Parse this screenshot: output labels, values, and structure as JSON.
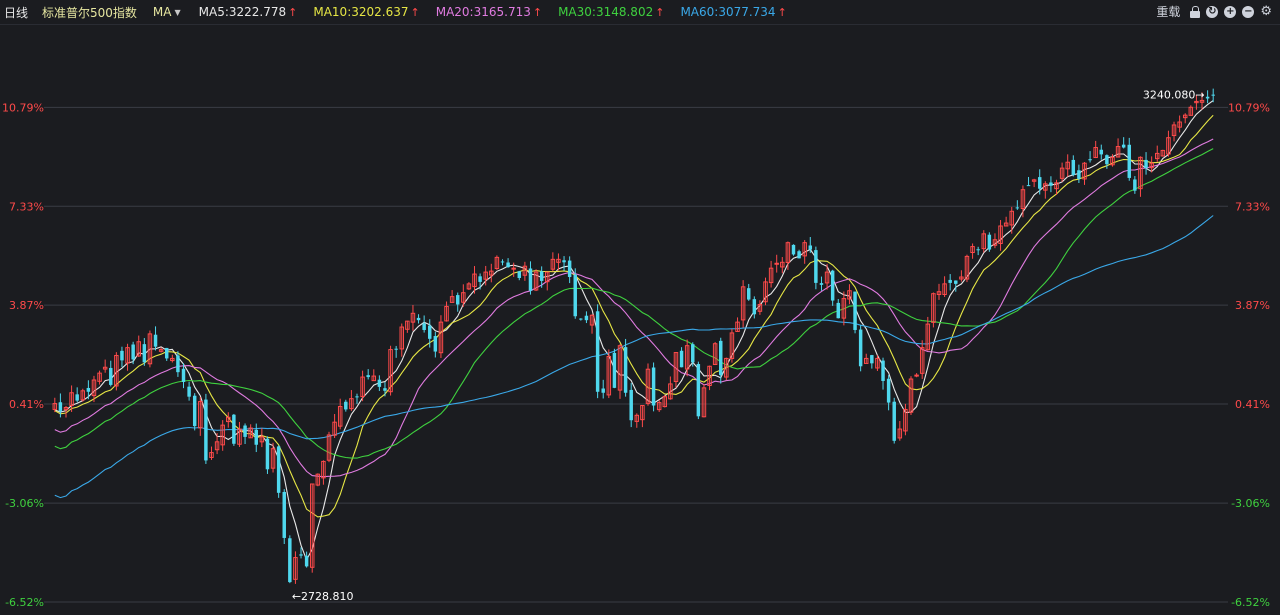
{
  "header": {
    "period": "日线",
    "index_name": "标准普尔500指数",
    "ma_menu": "MA",
    "ma_items": [
      {
        "label": "MA5:3222.778",
        "color": "#e8e8e8"
      },
      {
        "label": "MA10:3202.637",
        "color": "#e6e645"
      },
      {
        "label": "MA20:3165.713",
        "color": "#e07be0"
      },
      {
        "label": "MA30:3148.802",
        "color": "#3fd13f"
      },
      {
        "label": "MA60:3077.734",
        "color": "#3aa8e8"
      }
    ],
    "arrow": "↑",
    "reload": "重载"
  },
  "colors": {
    "up": "#ff4a4a",
    "down": "#4fd8ee",
    "grid": "#3a3c44",
    "neg_label": "#3fd13f",
    "pos_label": "#ff4a4a"
  },
  "chart_data": {
    "type": "candlestick",
    "y_tick_labels": [
      "10.79%",
      "7.33%",
      "3.87%",
      "0.41%",
      "-3.06%",
      "-6.52%"
    ],
    "y_pct_ticks": [
      10.79,
      7.33,
      3.87,
      0.41,
      -3.06,
      -6.52
    ],
    "base_price": 2912.6,
    "ylim_pct": [
      -6.52,
      13.5
    ],
    "annotations": [
      {
        "text": "3240.080→",
        "price": 3240.08,
        "index": 206
      },
      {
        "text": "←2728.810",
        "price": 2728.81,
        "index": 42
      }
    ],
    "close": [
      2925,
      2917,
      2921,
      2936,
      2928,
      2938,
      2937,
      2949,
      2956,
      2962,
      2944,
      2974,
      2969,
      2982,
      2970,
      2988,
      2967,
      2996,
      2983,
      2980,
      2971,
      2971,
      2957,
      2947,
      2932,
      2902,
      2927,
      2867,
      2875,
      2886,
      2903,
      2911,
      2884,
      2899,
      2891,
      2900,
      2883,
      2891,
      2858,
      2879,
      2834,
      2788,
      2743,
      2768,
      2770,
      2759,
      2843,
      2853,
      2866,
      2893,
      2906,
      2922,
      2919,
      2930,
      2932,
      2952,
      2952,
      2953,
      2942,
      2938,
      2980,
      2980,
      3003,
      3009,
      3017,
      3010,
      3000,
      2991,
      2978,
      3008,
      3024,
      3034,
      3026,
      3038,
      3047,
      3057,
      3049,
      3059,
      3060,
      3074,
      3069,
      3064,
      3063,
      3053,
      3065,
      3040,
      3059,
      3050,
      3059,
      3072,
      3072,
      3069,
      3054,
      3014,
      3011,
      3010,
      3015,
      2937,
      2936,
      2973,
      2941,
      2984,
      2936,
      2908,
      2913,
      2923,
      2960,
      2923,
      2926,
      2932,
      2945,
      2977,
      2962,
      2984,
      2967,
      2912,
      2941,
      2963,
      2986,
      2954,
      2971,
      2997,
      3008,
      3044,
      3031,
      3016,
      3026,
      3049,
      3063,
      3068,
      3069,
      3089,
      3077,
      3073,
      3089,
      3082,
      3048,
      3046,
      3059,
      3030,
      3012,
      3032,
      3040,
      3000,
      2963,
      2971,
      2966,
      2971,
      2948,
      2926,
      2887,
      2899,
      2919,
      2950,
      2954,
      2982,
      3006,
      3037,
      3039,
      3047,
      3048,
      3047,
      3054,
      3075,
      3085,
      3082,
      3098,
      3082,
      3092,
      3106,
      3109,
      3121,
      3124,
      3143,
      3147,
      3153,
      3144,
      3149,
      3147,
      3150,
      3165,
      3171,
      3158,
      3154,
      3170,
      3173,
      3186,
      3179,
      3169,
      3176,
      3187,
      3186,
      3155,
      3142,
      3176,
      3165,
      3170,
      3180,
      3183,
      3196,
      3209,
      3212,
      3219,
      3227,
      3233,
      3234,
      3236,
      3239
    ]
  }
}
